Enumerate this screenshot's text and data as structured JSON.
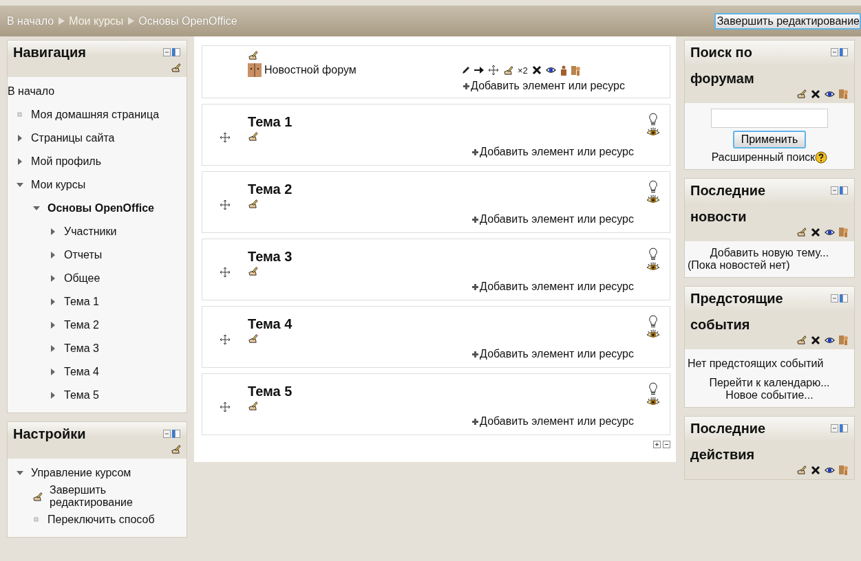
{
  "breadcrumb": [
    {
      "label": "В начало",
      "dimmed": false
    },
    {
      "label": "Мои курсы",
      "dimmed": true
    },
    {
      "label": "Основы OpenOffice",
      "dimmed": false
    }
  ],
  "edit_button": "Завершить редактирование",
  "navigation": {
    "title": "Навигация",
    "items": [
      {
        "label": "В начало",
        "kind": "root"
      },
      {
        "label": "Моя домашняя страница",
        "kind": "leaf"
      },
      {
        "label": "Страницы сайта",
        "kind": "branch",
        "expanded": false
      },
      {
        "label": "Мой профиль",
        "kind": "branch",
        "expanded": false
      },
      {
        "label": "Мои курсы",
        "kind": "branch",
        "expanded": true,
        "children": [
          {
            "label": "Основы OpenOffice",
            "kind": "branch",
            "expanded": true,
            "current": true,
            "children": [
              {
                "label": "Участники",
                "kind": "branch",
                "expanded": false
              },
              {
                "label": "Отчеты",
                "kind": "branch",
                "expanded": false
              },
              {
                "label": "Общее",
                "kind": "branch",
                "expanded": false
              },
              {
                "label": "Тема 1",
                "kind": "branch",
                "expanded": false
              },
              {
                "label": "Тема 2",
                "kind": "branch",
                "expanded": false
              },
              {
                "label": "Тема 3",
                "kind": "branch",
                "expanded": false
              },
              {
                "label": "Тема 4",
                "kind": "branch",
                "expanded": false
              },
              {
                "label": "Тема 5",
                "kind": "branch",
                "expanded": false
              }
            ]
          }
        ]
      }
    ]
  },
  "settings": {
    "title": "Настройки",
    "items": [
      {
        "label": "Управление курсом",
        "kind": "branch",
        "expanded": true,
        "children": [
          {
            "label": "Завершить редактирование",
            "kind": "edit"
          },
          {
            "label": "Переключить способ",
            "kind": "leaf"
          }
        ]
      }
    ]
  },
  "sections": [
    {
      "kind": "general",
      "activities": [
        {
          "name": "Новостной форум",
          "duplicate_label": "×2"
        }
      ],
      "add_label": "Добавить элемент или ресурс"
    },
    {
      "kind": "topic",
      "title": "Тема 1",
      "add_label": "Добавить элемент или ресурс"
    },
    {
      "kind": "topic",
      "title": "Тема 2",
      "add_label": "Добавить элемент или ресурс"
    },
    {
      "kind": "topic",
      "title": "Тема 3",
      "add_label": "Добавить элемент или ресурс"
    },
    {
      "kind": "topic",
      "title": "Тема 4",
      "add_label": "Добавить элемент или ресурс"
    },
    {
      "kind": "topic",
      "title": "Тема 5",
      "add_label": "Добавить элемент или ресурс"
    }
  ],
  "blocks": [
    {
      "title": "Поиск по форумам",
      "kind": "search",
      "button": "Применить",
      "link": "Расширенный поиск"
    },
    {
      "title": "Последние новости",
      "kind": "news",
      "links": [
        "Добавить новую тему..."
      ],
      "note": "(Пока новостей нет)"
    },
    {
      "title": "Предстоящие события",
      "kind": "events",
      "note": "Нет предстоящих событий",
      "links": [
        "Перейти к календарю...",
        "Новое событие..."
      ]
    },
    {
      "title": "Последние действия",
      "kind": "empty"
    }
  ]
}
